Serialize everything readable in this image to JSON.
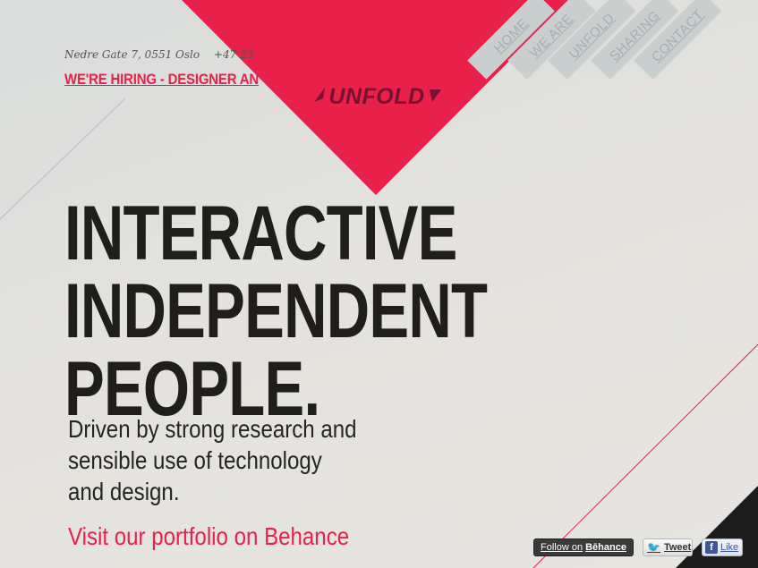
{
  "header": {
    "address": "Nedre Gate 7, 0551 Oslo",
    "phone": "+47 23",
    "hiring": "WE'RE HIRING - DESIGNER AN"
  },
  "logo": {
    "text": "UNFOLD",
    "color": "#7a1030"
  },
  "nav": {
    "items": [
      {
        "label": "HOME"
      },
      {
        "label": "WE ARE"
      },
      {
        "label": "UNFOLD"
      },
      {
        "label": "SHARING"
      },
      {
        "label": "CONTACT"
      }
    ]
  },
  "hero": {
    "line1": "INTERACTIVE",
    "line2": "INDEPENDENT",
    "line3": "PEOPLE.",
    "subtitle_line1": "Driven by strong research and",
    "subtitle_line2": "sensible use of technology",
    "subtitle_line3": "and design.",
    "link": "Visit our portfolio on Behance"
  },
  "social": {
    "behance_prefix": "Follow on",
    "behance_brand": "Bēhance",
    "tweet": "Tweet",
    "like": "Like"
  },
  "colors": {
    "accent": "#e8204a",
    "text": "#1f1e1c",
    "nav_tab": "#c9cecf",
    "background": "#e4e3de"
  },
  "icons": {
    "twitter": "twitter-bird-icon",
    "facebook": "facebook-f-icon"
  }
}
